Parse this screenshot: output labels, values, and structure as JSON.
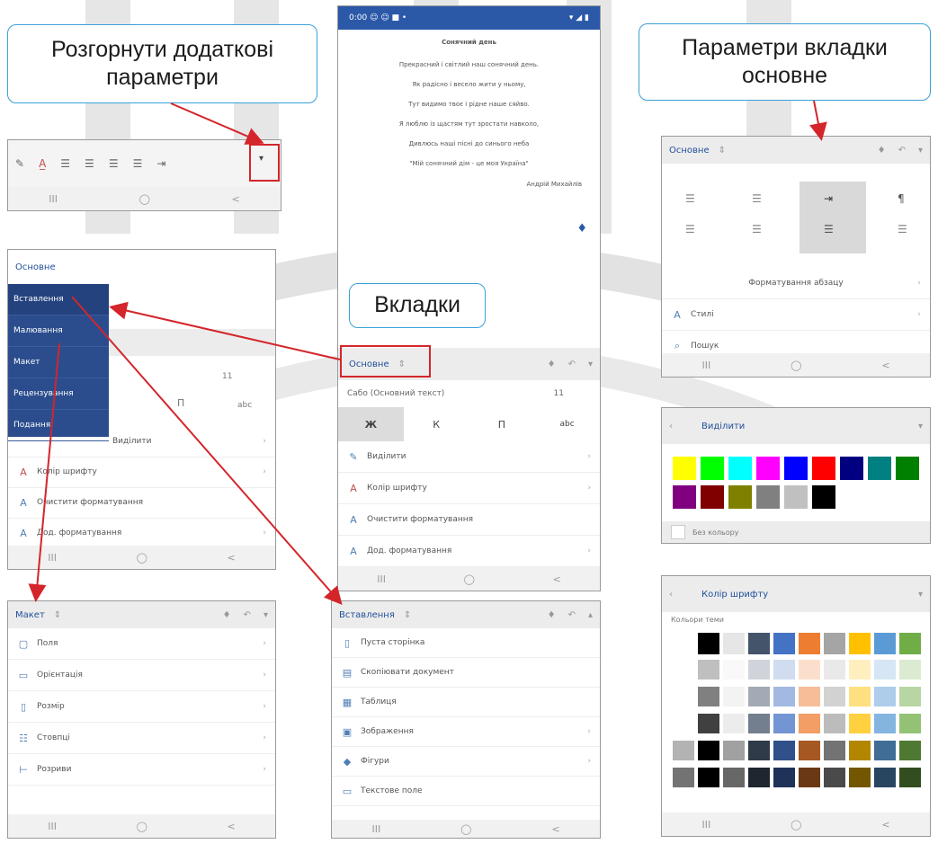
{
  "callouts": {
    "expand": "Розгорнути додаткові параметри",
    "home_params": "Параметри вкладки основне",
    "tabs": "Вкладки"
  },
  "phone": {
    "status_left": "0:00 ☺ ☺ ■ •",
    "status_right": "▾ ◢ ▮",
    "doc_title": "Сонячний день",
    "doc_lines": [
      "Прекрасний і світлий наш сонячний день.",
      "Як радісно і весело жити у ньому,",
      "Тут видимо твоє і рідне наше сяйво.",
      "Я люблю із щастям тут зростати навколо,",
      "Дивлюсь наші пісні до синього неба",
      "\"Мій сонячний дім - це моя Україна\""
    ],
    "doc_author": "Андрій Михайлів",
    "tab_label": "Основне",
    "style_label": "Сабо (Основний текст)",
    "style_size": "11",
    "fmt_buttons": [
      "Ж",
      "К",
      "П",
      "abc"
    ],
    "rows": [
      "Виділити",
      "Колір шрифту",
      "Очистити форматування",
      "Дод. форматування"
    ]
  },
  "toolbar_panel": {
    "nav": [
      "III",
      "◯",
      "<"
    ]
  },
  "dropdown_panel": {
    "header": "Основне",
    "items": [
      "Вставлення",
      "Малювання",
      "Макет",
      "Рецензування",
      "Подання"
    ],
    "size": "11",
    "rows": [
      "Виділити",
      "Колір шрифту",
      "Очистити форматування",
      "Дод. форматування"
    ]
  },
  "layout_panel": {
    "tab": "Макет",
    "rows": [
      "Поля",
      "Орієнтація",
      "Розмір",
      "Стовпці",
      "Розриви"
    ]
  },
  "insert_panel": {
    "tab": "Вставлення",
    "rows": [
      "Пуста сторінка",
      "Скопіювати документ",
      "Таблиця",
      "Зображення",
      "Фігури",
      "Текстове поле"
    ]
  },
  "home_params_panel": {
    "tab": "Основне",
    "sub": "Форматування абзацу",
    "rows": [
      "Стилі",
      "Пошук"
    ]
  },
  "highlight_panel": {
    "title": "Виділити",
    "colors": [
      "#ffff00",
      "#00ff00",
      "#00ffff",
      "#ff00ff",
      "#0000ff",
      "#ff0000",
      "#000080",
      "#008080",
      "#008000",
      "#800080",
      "#800000",
      "#808000",
      "#808080",
      "#c0c0c0",
      "#000000"
    ],
    "no_color": "Без кольору"
  },
  "fontcolor_panel": {
    "title": "Колір шрифту",
    "sub": "Кольори теми",
    "top_colors": [
      "#ffffff",
      "#000000",
      "#e7e6e6",
      "#44546a",
      "#4472c4",
      "#ed7d31",
      "#a5a5a5",
      "#ffc000",
      "#5b9bd5",
      "#70ad47"
    ]
  },
  "nav_icons": [
    "III",
    "◯",
    "<"
  ]
}
